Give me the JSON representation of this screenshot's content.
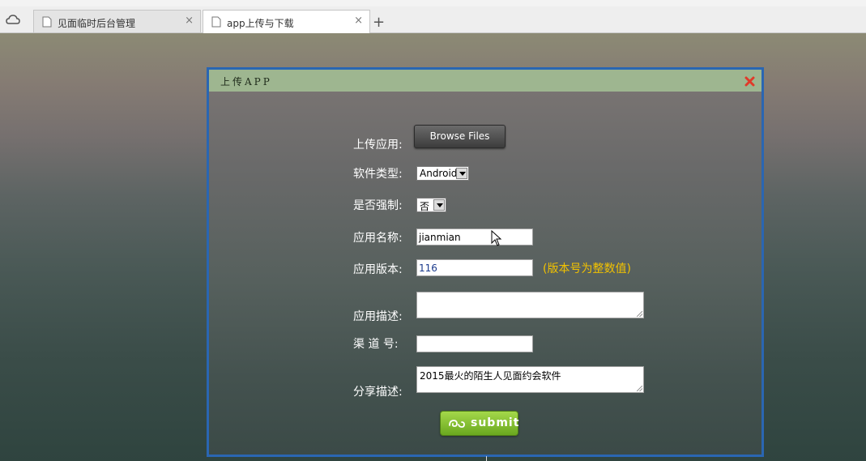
{
  "browser": {
    "tabs": [
      {
        "label": "见面临时后台管理",
        "active": false
      },
      {
        "label": "app上传与下载",
        "active": true
      }
    ],
    "new_tab_label": "+",
    "close_label": "×"
  },
  "dialog": {
    "title": "上传APP",
    "form": {
      "upload_label": "上传应用:",
      "browse_button": "Browse Files",
      "type_label": "软件类型:",
      "type_value": "Android",
      "force_label": "是否强制:",
      "force_value": "否",
      "name_label": "应用名称:",
      "name_value": "jianmian",
      "version_label": "应用版本:",
      "version_value": "116",
      "version_hint": "(版本号为整数值)",
      "desc_label": "应用描述:",
      "desc_value": "",
      "channel_label": "渠 道 号:",
      "channel_value": "",
      "share_label": "分享描述:",
      "share_value": "2015最火的陌生人见面约会软件",
      "submit_label": "submit"
    }
  },
  "colors": {
    "dialog_border": "#2a66b2",
    "header_bg": "#9eb690",
    "hint_text": "#f2c200",
    "submit_green": "#8cc63f",
    "close_red": "#e03a2a"
  }
}
